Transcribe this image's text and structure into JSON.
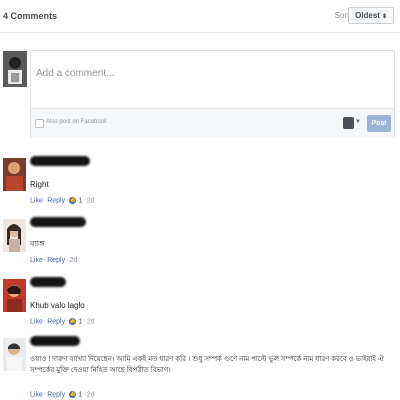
{
  "header": {
    "count": "4 Comments",
    "sort_label": "Sort by",
    "sort_value": "Oldest"
  },
  "composer": {
    "placeholder": "Add a comment...",
    "also_post": "Also post on Facebook",
    "post_button": "Post"
  },
  "comments": [
    {
      "text": "Right",
      "like": "Like",
      "reply": "Reply",
      "likes": "1",
      "time": "2d"
    },
    {
      "text": "ব্যাঙ্গ",
      "like": "Like",
      "reply": "Reply",
      "time": "2d"
    },
    {
      "text": "Khub valo laglo",
      "like": "Like",
      "reply": "Reply",
      "likes": "1",
      "time": "2d"
    },
    {
      "text": "ওয়াও ! দারুণ ব্যাখ্যা দিয়েছেন। আমি একই মত ধারণ করি । শুধু সম্পর্ক গুণে নাম পাল্টে ভুল সম্পর্কে নাম ধারণ করবে ও ভাইরাই ঐ সম্পর্কের মুক্তি দেওয়া নিহিত আছে বিপরীত বিভাগ।",
      "like": "Like",
      "reply": "Reply",
      "likes": "1",
      "time": "2d"
    }
  ],
  "colors": {
    "link": "#4267b2",
    "post_button": "#9cb4d8"
  }
}
